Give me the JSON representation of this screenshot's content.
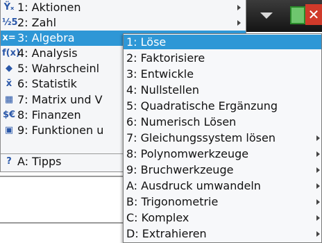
{
  "titlebar": {
    "arrow_icon": "triangle-down",
    "battery_icon": "battery",
    "close_icon": "x",
    "close_glyph": "✕"
  },
  "main_menu": {
    "items": [
      {
        "label": "1: Aktionen",
        "icon": "actions-icon",
        "glyph": "Ϋₓ",
        "submenu": true,
        "selected": false
      },
      {
        "label": "2: Zahl",
        "icon": "number-icon",
        "glyph": "½5",
        "submenu": true,
        "selected": false
      },
      {
        "label": "3: Algebra",
        "icon": "algebra-icon",
        "glyph": "x=",
        "submenu": true,
        "selected": true
      },
      {
        "label": "4: Analysis",
        "icon": "calculus-icon",
        "glyph": "f(x)",
        "submenu": true,
        "selected": false
      },
      {
        "label": "5: Wahrscheinl",
        "icon": "probability-icon",
        "glyph": "◆",
        "submenu": true,
        "selected": false
      },
      {
        "label": "6: Statistik",
        "icon": "statistics-icon",
        "glyph": "x̄",
        "submenu": true,
        "selected": false
      },
      {
        "label": "7: Matrix und V",
        "icon": "matrix-icon",
        "glyph": "▦",
        "submenu": true,
        "selected": false
      },
      {
        "label": "8: Finanzen",
        "icon": "finance-icon",
        "glyph": "$€",
        "submenu": true,
        "selected": false
      },
      {
        "label": "9: Funktionen u",
        "icon": "functions-icon",
        "glyph": "▣",
        "submenu": true,
        "selected": false
      },
      {
        "label": "A: Tipps",
        "icon": "help-icon",
        "glyph": "?",
        "submenu": false,
        "selected": false
      }
    ]
  },
  "sub_menu": {
    "items": [
      {
        "label": "1: Löse",
        "submenu": false,
        "selected": true
      },
      {
        "label": "2: Faktorisiere",
        "submenu": false,
        "selected": false
      },
      {
        "label": "3: Entwickle",
        "submenu": false,
        "selected": false
      },
      {
        "label": "4: Nullstellen",
        "submenu": false,
        "selected": false
      },
      {
        "label": "5: Quadratische Ergänzung",
        "submenu": false,
        "selected": false
      },
      {
        "label": "6: Numerisch Lösen",
        "submenu": false,
        "selected": false
      },
      {
        "label": "7: Gleichungssystem lösen",
        "submenu": true,
        "selected": false
      },
      {
        "label": "8: Polynomwerkzeuge",
        "submenu": true,
        "selected": false
      },
      {
        "label": "9: Bruchwerkzeuge",
        "submenu": true,
        "selected": false
      },
      {
        "label": "A: Ausdruck umwandeln",
        "submenu": true,
        "selected": false
      },
      {
        "label": "B: Trigonometrie",
        "submenu": true,
        "selected": false
      },
      {
        "label": "C: Komplex",
        "submenu": true,
        "selected": false
      },
      {
        "label": "D: Extrahieren",
        "submenu": true,
        "selected": false
      }
    ]
  },
  "colors": {
    "selection": "#2e97d6",
    "menu_bg": "#f5f6f8",
    "titlebar": "#1e1e1e"
  }
}
